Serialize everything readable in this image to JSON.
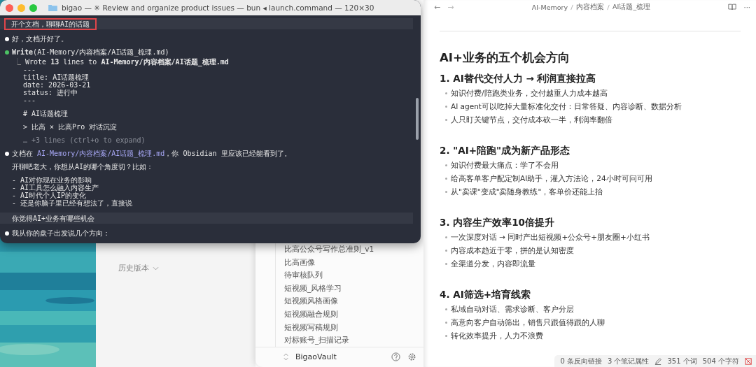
{
  "terminal": {
    "title": "bigao — ✳ Review and organize product issues — bun ◂ launch.command — 120×30",
    "lines": [
      {
        "kind": "prompt",
        "text": "开个文档，聊聊AI的话题",
        "boxed": true
      },
      {
        "kind": "blank"
      },
      {
        "kind": "bullet",
        "text": "好，文档开好了。"
      },
      {
        "kind": "blank"
      },
      {
        "kind": "tool",
        "text": "**Write**(AI-Memory/内容档案/AI话题_梳理.md)"
      },
      {
        "kind": "result",
        "marker": "⎿",
        "text": "Wrote **13** lines to **AI-Memory/内容档案/AI话题_梳理.md**"
      },
      {
        "kind": "detail",
        "text": "---"
      },
      {
        "kind": "detail",
        "text": "title: AI话题梳理"
      },
      {
        "kind": "detail",
        "text": "date: 2026-03-21"
      },
      {
        "kind": "detail",
        "text": "status: 进行中"
      },
      {
        "kind": "detail",
        "text": "---"
      },
      {
        "kind": "blank"
      },
      {
        "kind": "detail",
        "text": "# AI话题梳理"
      },
      {
        "kind": "blank"
      },
      {
        "kind": "detail",
        "text": "> 比高 × 比高Pro 对话沉淀"
      },
      {
        "kind": "blank"
      },
      {
        "kind": "muted",
        "text": "… +3 lines (ctrl+o to expand)"
      },
      {
        "kind": "blank"
      },
      {
        "kind": "link_bullet",
        "before": "文档在 ",
        "link": "AI-Memory/内容档案/AI话题_梳理.md",
        "after": "，你 Obsidian 里应该已经能看到了。"
      },
      {
        "kind": "blank"
      },
      {
        "kind": "body",
        "text": "开聊吧老大，你想从AI的哪个角度切？比如："
      },
      {
        "kind": "blank"
      },
      {
        "kind": "body",
        "text": "- AI对你现在业务的影响"
      },
      {
        "kind": "body",
        "text": "- AI工具怎么融入内容生产"
      },
      {
        "kind": "body",
        "text": "- AI时代个人IP的变化"
      },
      {
        "kind": "body",
        "text": "- 还是你脑子里已经有想法了，直接说"
      },
      {
        "kind": "blank"
      },
      {
        "kind": "prompt",
        "text": "你觉得AI+业务有哪些机会",
        "boxed": false
      },
      {
        "kind": "blank"
      },
      {
        "kind": "bullet",
        "text": "我从你的盘子出发说几个方向："
      }
    ]
  },
  "history": {
    "label": "历史版本"
  },
  "file_list": {
    "items": [
      "比高公众号写作总准则_v1",
      "比高画像",
      "待审核队列",
      "短视频_风格学习",
      "短视频风格画像",
      "短视频融合规则",
      "短视频写稿规则",
      "对标账号_扫描记录"
    ],
    "vault": "BigaoVault"
  },
  "editor": {
    "back": "←",
    "forward": "→",
    "breadcrumb": [
      "AI-Memory",
      "内容档案",
      "AI话题_梳理"
    ],
    "more": "···",
    "title": "AI+业务的五个机会方向",
    "sections": [
      {
        "heading": "1. AI替代交付人力 → 利润直接拉高",
        "bullets": [
          "知识付费/陪跑类业务，交付越重人力成本越高",
          "AI agent可以吃掉大量标准化交付：日常答疑、内容诊断、数据分析",
          "人只盯关键节点，交付成本砍一半，利润率翻倍"
        ]
      },
      {
        "heading": "2. \"AI+陪跑\"成为新产品形态",
        "bullets": [
          "知识付费最大痛点：学了不会用",
          "给高客单客户配定制AI助手，灌入方法论，24小时可问可用",
          "从\"卖课\"变成\"卖随身教练\"，客单价还能上抬"
        ]
      },
      {
        "heading": "3. 内容生产效率10倍提升",
        "bullets": [
          "一次深度对话 → 同时产出短视频+公众号+朋友圈+小红书",
          "内容成本趋近于零，拼的是认知密度",
          "全渠道分发，内容即流量"
        ]
      },
      {
        "heading": "4. AI筛选+培育线索",
        "bullets": [
          "私域自动对话、需求诊断、客户分层",
          "高意向客户自动筛出，销售只跟值得跟的人聊",
          "转化效率提升，人力不浪费"
        ]
      }
    ],
    "status": {
      "backlinks": "0 条反向链接",
      "properties": "3 个笔记属性",
      "words": "351 个词",
      "chars": "504 个字符"
    }
  }
}
